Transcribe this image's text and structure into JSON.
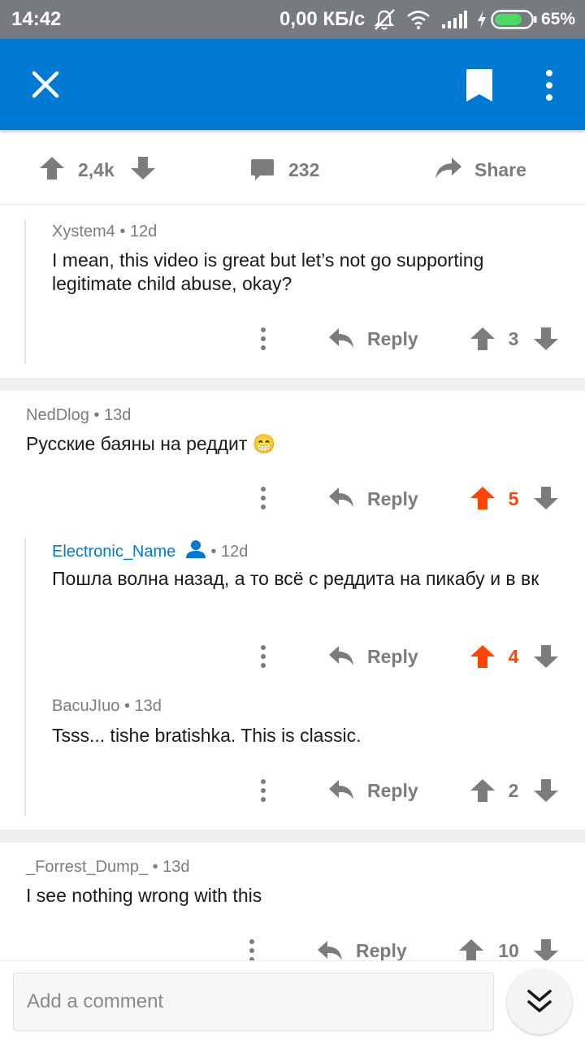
{
  "status_bar": {
    "time": "14:42",
    "network_speed": "0,00 КБ/с",
    "battery": "65%"
  },
  "app_bar": {
    "icons": [
      "close-icon",
      "bookmark-icon",
      "more-vertical-icon"
    ],
    "color": "#0079d3"
  },
  "post_actions": {
    "score": "2,4k",
    "comments": "232",
    "share_label": "Share"
  },
  "comments": [
    {
      "author": "Xystem4",
      "age": "12d",
      "body": "I mean, this video is great but let’s not go supporting legitimate child abuse, okay?",
      "reply_label": "Reply",
      "score": "3",
      "upvoted": false
    },
    {
      "author": "NedDlog",
      "age": "13d",
      "body": "Русские баяны на реддит 😁",
      "reply_label": "Reply",
      "score": "5",
      "upvoted": true
    },
    {
      "author": "Electronic_Name",
      "age": "12d",
      "body": "Пошла волна назад, а то всё с реддита на пикабу и в вк",
      "reply_label": "Reply",
      "score": "4",
      "upvoted": true,
      "is_op": true
    },
    {
      "author": "BacuJIuo",
      "age": "13d",
      "body": "Tsss... tishe bratishka. This is classic.",
      "reply_label": "Reply",
      "score": "2",
      "upvoted": false
    },
    {
      "author": "_Forrest_Dump_",
      "age": "13d",
      "body": "I see nothing wrong with this",
      "reply_label": "Reply",
      "score": "10",
      "upvoted": false
    }
  ],
  "bottom_bar": {
    "comment_placeholder": "Add a comment"
  },
  "colors": {
    "upvote": "#ff4500",
    "muted": "#7c7c7c",
    "separator": "#edeff1"
  }
}
